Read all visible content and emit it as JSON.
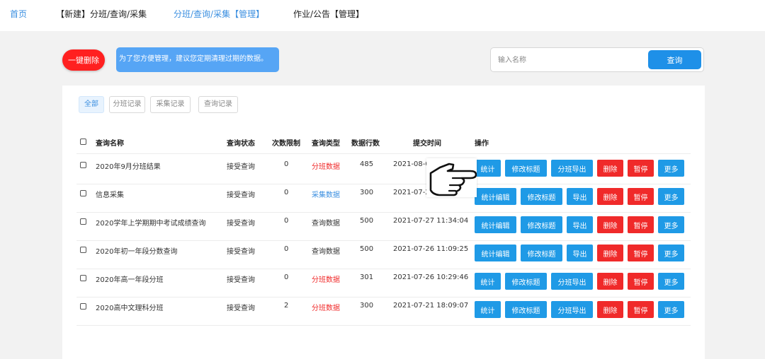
{
  "nav": {
    "home": "首页",
    "new_item": "【新建】分班/查询/采集",
    "manage": "分班/查询/采集【管理】",
    "homework": "作业/公告【管理】"
  },
  "toolbar": {
    "delete_all": "一键删除",
    "tip": "为了您方便管理，建议您定期清理过期的数据。",
    "search_placeholder": "输入名称",
    "search_button": "查询"
  },
  "filters": [
    "全部",
    "分班记录",
    "采集记录",
    "查询记录"
  ],
  "active_filter": "全部",
  "table": {
    "headers": {
      "name": "查询名称",
      "status": "查询状态",
      "limit": "次数限制",
      "type": "查询类型",
      "rows": "数据行数",
      "time": "提交时间",
      "ops": "操作"
    },
    "rows": [
      {
        "name": "2020年9月分班结果",
        "status": "接受查询",
        "limit": "0",
        "type": "分班数据",
        "type_color": "red",
        "rows": "485",
        "time": "2021-08-0",
        "ops": [
          [
            "统计",
            "blue"
          ],
          [
            "修改标题",
            "blue"
          ],
          [
            "分班导出",
            "blue"
          ],
          [
            "删除",
            "red"
          ],
          [
            "暂停",
            "red"
          ],
          [
            "更多",
            "blue"
          ]
        ]
      },
      {
        "name": "信息采集",
        "status": "接受查询",
        "limit": "0",
        "type": "采集数据",
        "type_color": "blue",
        "rows": "300",
        "time": "2021-07-2",
        "ops": [
          [
            "统计编辑",
            "blue"
          ],
          [
            "修改标题",
            "blue"
          ],
          [
            "导出",
            "blue"
          ],
          [
            "删除",
            "red"
          ],
          [
            "暂停",
            "red"
          ],
          [
            "更多",
            "blue"
          ]
        ]
      },
      {
        "name": "2020学年上学期期中考试成绩查询",
        "status": "接受查询",
        "limit": "0",
        "type": "查询数据",
        "type_color": "gray",
        "rows": "500",
        "time": "2021-07-27 11:34:04",
        "ops": [
          [
            "统计编辑",
            "blue"
          ],
          [
            "修改标题",
            "blue"
          ],
          [
            "导出",
            "blue"
          ],
          [
            "删除",
            "red"
          ],
          [
            "暂停",
            "red"
          ],
          [
            "更多",
            "blue"
          ]
        ]
      },
      {
        "name": "2020年初一年段分数查询",
        "status": "接受查询",
        "limit": "0",
        "type": "查询数据",
        "type_color": "gray",
        "rows": "500",
        "time": "2021-07-26 11:09:25",
        "ops": [
          [
            "统计编辑",
            "blue"
          ],
          [
            "修改标题",
            "blue"
          ],
          [
            "导出",
            "blue"
          ],
          [
            "删除",
            "red"
          ],
          [
            "暂停",
            "red"
          ],
          [
            "更多",
            "blue"
          ]
        ]
      },
      {
        "name": "2020年高一年段分班",
        "status": "接受查询",
        "limit": "0",
        "type": "分班数据",
        "type_color": "red",
        "rows": "301",
        "time": "2021-07-26 10:29:46",
        "ops": [
          [
            "统计",
            "blue"
          ],
          [
            "修改标题",
            "blue"
          ],
          [
            "分班导出",
            "blue"
          ],
          [
            "删除",
            "red"
          ],
          [
            "暂停",
            "red"
          ],
          [
            "更多",
            "blue"
          ]
        ]
      },
      {
        "name": "2020高中文理科分班",
        "status": "接受查询",
        "limit": "2",
        "type": "分班数据",
        "type_color": "red",
        "rows": "300",
        "time": "2021-07-21 18:09:07",
        "ops": [
          [
            "统计",
            "blue"
          ],
          [
            "修改标题",
            "blue"
          ],
          [
            "分班导出",
            "blue"
          ],
          [
            "删除",
            "red"
          ],
          [
            "暂停",
            "red"
          ],
          [
            "更多",
            "blue"
          ]
        ]
      }
    ]
  },
  "icons": {
    "pointer": "pointing-hand-icon"
  },
  "colors": {
    "accent": "#1e90e8",
    "danger": "#f02a2a",
    "tip": "#56a5f5"
  }
}
